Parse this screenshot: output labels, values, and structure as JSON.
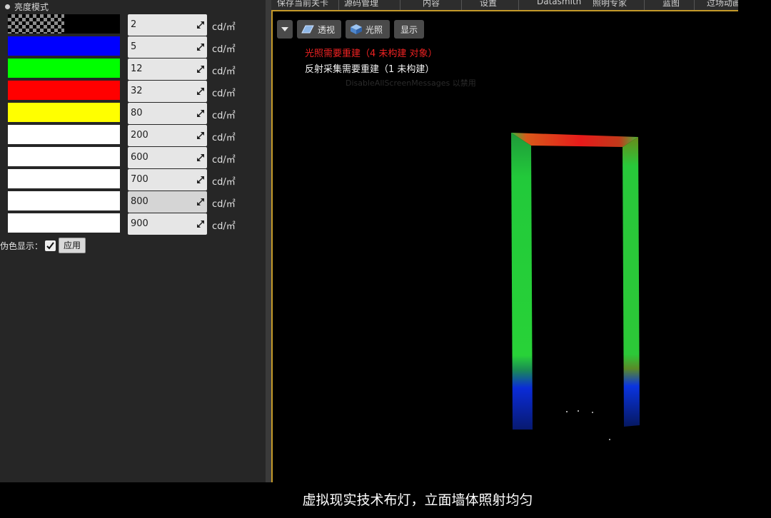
{
  "panel": {
    "mode_label": "亮度模式",
    "rows": [
      {
        "value": "2",
        "unit": "cd/㎡",
        "color": "transparent"
      },
      {
        "value": "5",
        "unit": "cd/㎡",
        "color": "#0000ff"
      },
      {
        "value": "12",
        "unit": "cd/㎡",
        "color": "#00ff00"
      },
      {
        "value": "32",
        "unit": "cd/㎡",
        "color": "#ff0000"
      },
      {
        "value": "80",
        "unit": "cd/㎡",
        "color": "#ffff00"
      },
      {
        "value": "200",
        "unit": "cd/㎡",
        "color": "#ffffff"
      },
      {
        "value": "600",
        "unit": "cd/㎡",
        "color": "#ffffff"
      },
      {
        "value": "700",
        "unit": "cd/㎡",
        "color": "#ffffff"
      },
      {
        "value": "800",
        "unit": "cd/㎡",
        "color": "#ffffff"
      },
      {
        "value": "900",
        "unit": "cd/㎡",
        "color": "#ffffff"
      }
    ],
    "false_color_label": "伪色显示：",
    "false_color_checked": true,
    "apply_label": "应用"
  },
  "top_tabs": [
    "保存当前关卡",
    "源码管理",
    "内容",
    "设置",
    "Datasmith",
    "照明专家",
    "蓝图",
    "过场动画"
  ],
  "viewport": {
    "buttons": {
      "perspective": "透视",
      "lighting": "光照",
      "show": "显示"
    },
    "status_lighting": "光照需要重建（4 未构建 对象）",
    "status_reflection": "反射采集需要重建（1 未构建）",
    "status_faint": "DisableAllScreenMessages 以禁用"
  },
  "subtitle": "虚拟现实技术布灯，立面墙体照射均匀"
}
